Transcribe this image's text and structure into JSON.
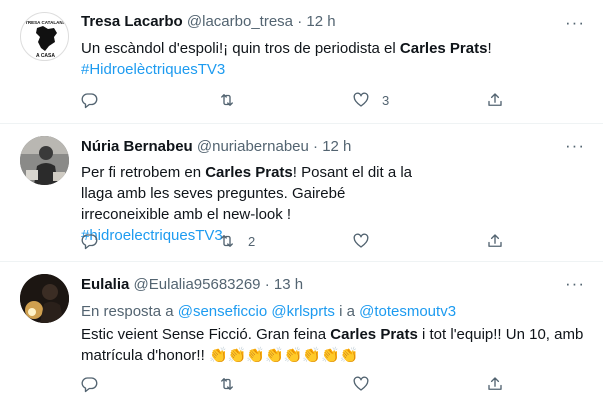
{
  "tweets": [
    {
      "name": "Tresa Lacarbo",
      "handle": "@lacarbo_tresa",
      "dot": "·",
      "time": "12 h",
      "text_before": "Un escàndol d'espoli!¡ quin tros de periodista el ",
      "text_bold": "Carles Prats",
      "text_after": "!",
      "hashtag": "#HidroelèctriquesTV3",
      "likes": "3",
      "retweets": ""
    },
    {
      "name": "Núria Bernabeu",
      "handle": "@nuriabernabeu",
      "dot": "·",
      "time": "12 h",
      "text_before": "Per fi retrobem en ",
      "text_bold": "Carles Prats",
      "text_after": "! Posant el dit a la llaga amb les seves preguntes. Gairebé irreconeixible amb el new-look !",
      "hashtag": "#hidroelectriquesTV3",
      "likes": "",
      "retweets": "2"
    },
    {
      "name": "Eulalia",
      "handle": "@Eulalia95683269",
      "dot": "·",
      "time": "13 h",
      "reply_prefix": "En resposta a ",
      "reply_user1": "@senseficcio",
      "reply_user2": "@krlsprts",
      "reply_and": " i a ",
      "reply_user3": "@totesmoutv3",
      "text_before": "Estic veient Sense Ficció. Gran feina ",
      "text_bold": "Carles Prats",
      "text_after": " i tot l'equip!! Un 10, amb matrícula d'honor!! ",
      "claps": "👏👏👏👏👏👏👏👏",
      "likes": "",
      "retweets": ""
    }
  ],
  "more_glyph": "···",
  "icons": [
    "reply-icon",
    "retweet-icon",
    "like-icon",
    "share-icon",
    "more-icon"
  ],
  "colors": {
    "link": "#1d9bf0",
    "muted": "#536471",
    "text": "#0f1419",
    "divider": "#eff3f4"
  }
}
